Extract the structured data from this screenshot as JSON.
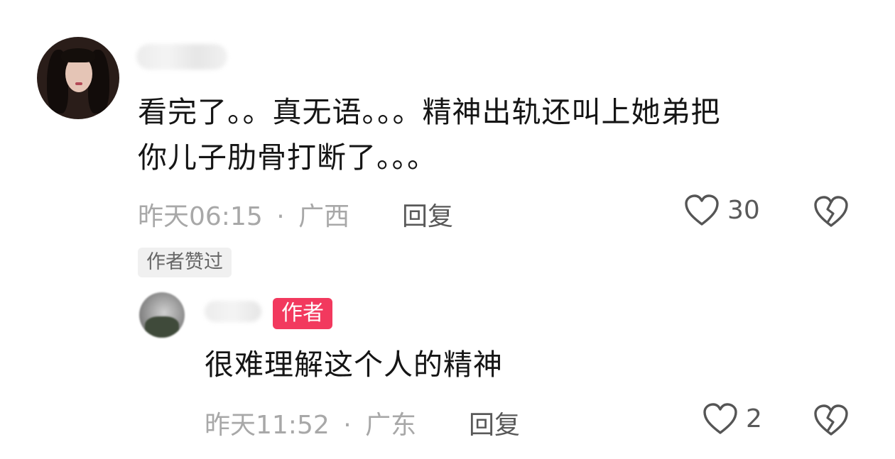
{
  "comment": {
    "text_line1": "看完了。。真无语。。。精神出轨还叫上她弟把",
    "text_line2": "你儿子肋骨打断了。。。",
    "time": "昨天06:15",
    "separator": "·",
    "location": "广西",
    "reply_label": "回复",
    "like_count": "30",
    "author_liked_badge": "作者赞过"
  },
  "reply": {
    "author_badge": "作者",
    "text": "很难理解这个人的精神",
    "time": "昨天11:52",
    "separator": "·",
    "location": "广东",
    "reply_label": "回复",
    "like_count": "2"
  },
  "icons": {
    "like": "heart-outline-icon",
    "dislike": "broken-heart-icon"
  },
  "colors": {
    "author_badge_bg": "#f2395e",
    "meta_gray": "#a8a8a8",
    "action_gray": "#595959"
  }
}
